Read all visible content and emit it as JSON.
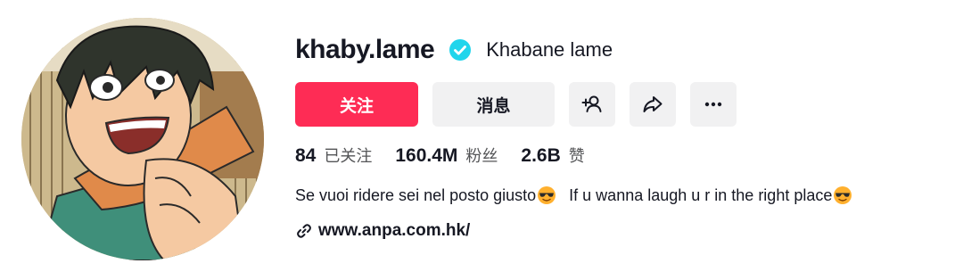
{
  "profile": {
    "username": "khaby.lame",
    "nickname": "Khabane lame",
    "verified": true
  },
  "actions": {
    "follow_label": "关注",
    "message_label": "消息",
    "add_friend_icon": "add-user-icon",
    "share_icon": "share-arrow-icon",
    "more_icon": "more-dots-icon"
  },
  "stats": {
    "following_count": "84",
    "following_label": "已关注",
    "followers_count": "160.4M",
    "followers_label": "粉丝",
    "likes_count": "2.6B",
    "likes_label": "赞"
  },
  "bio": {
    "part1": "Se vuoi ridere sei nel posto giusto",
    "part2": "If u wanna laugh u r in the right place",
    "emoji": "smiling-face-with-sunglasses"
  },
  "link": {
    "url": "www.anpa.com.hk/",
    "icon": "link-icon"
  },
  "colors": {
    "follow_button": "#fe2c55",
    "secondary_button": "#f1f1f2",
    "verified_badge": "#20d5ec",
    "text_primary": "#161823",
    "text_secondary": "#545557"
  }
}
